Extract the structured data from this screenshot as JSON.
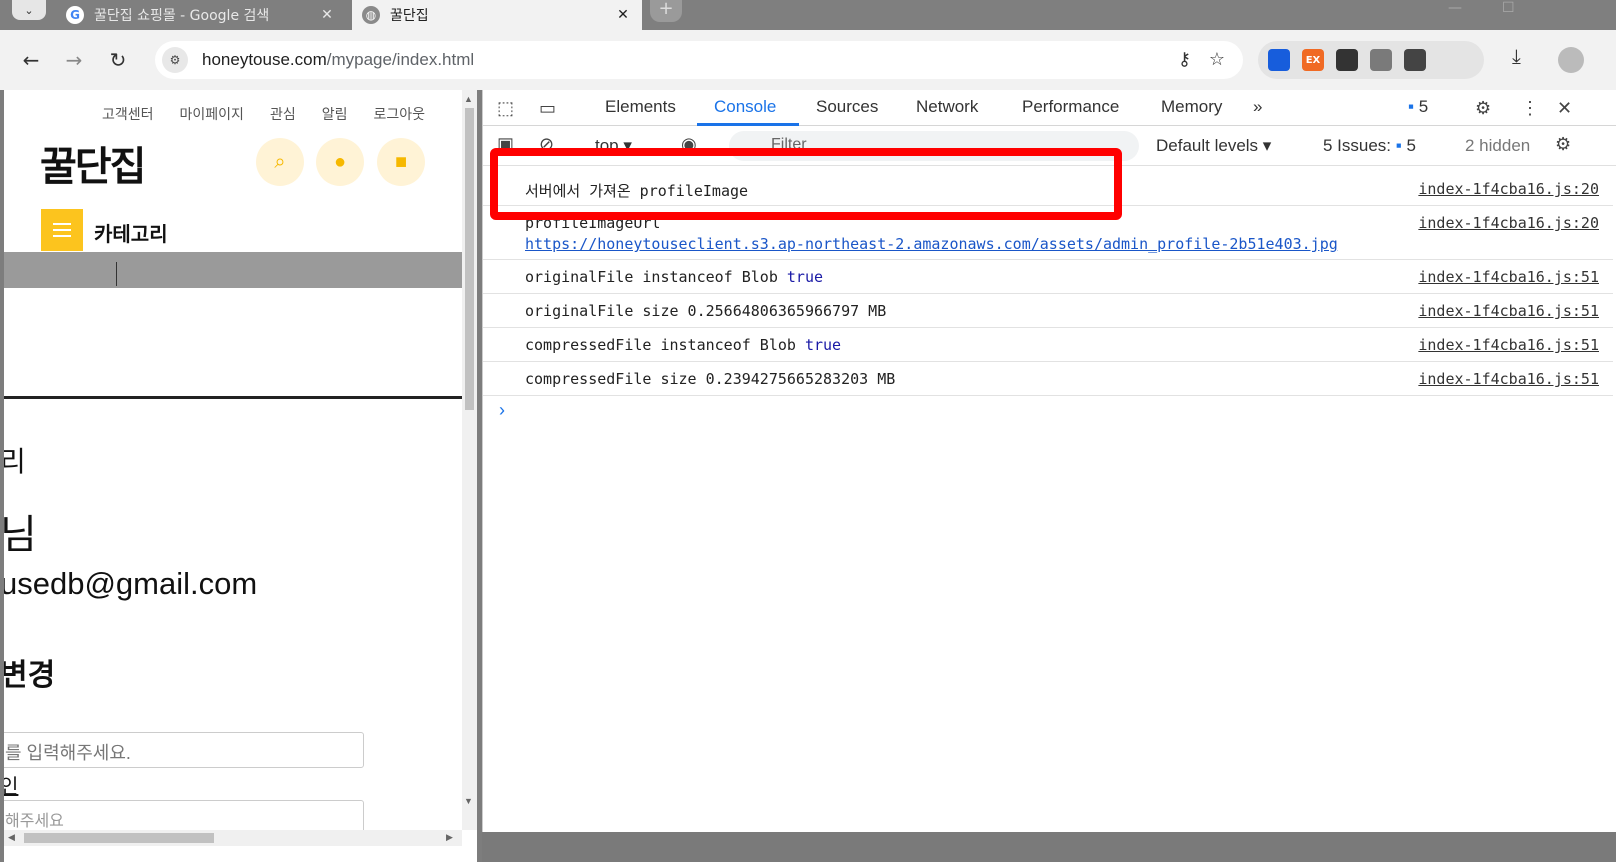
{
  "browser": {
    "tabs": [
      {
        "title": "꿀단집 쇼핑몰 - Google 검색",
        "active": false
      },
      {
        "title": "꿀단집",
        "active": true
      }
    ],
    "url_host": "honeytouse.com",
    "url_path": "/mypage/index.html",
    "extensions": [
      {
        "name": "bitwarden-icon",
        "label": "",
        "color": "#175ddc"
      },
      {
        "name": "ex-extension-icon",
        "label": "EX",
        "color": "#f06a24"
      },
      {
        "name": "notion-clipper-icon",
        "label": "",
        "color": "#333333"
      },
      {
        "name": "react-devtools-icon",
        "label": "",
        "color": "#7a7a7a"
      },
      {
        "name": "puzzle-extensions-icon",
        "label": "",
        "color": "#444444"
      }
    ]
  },
  "page": {
    "util_nav": [
      "고객센터",
      "마이페이지",
      "관심",
      "알림",
      "로그아웃"
    ],
    "logo": "꿀단집",
    "category_label": "카테고리",
    "heading_partial": "리",
    "name_partial": "님",
    "email_partial": "usedb@gmail.com",
    "change_heading_partial": "변경",
    "input_placeholder_partial": "를 입력해주세요.",
    "link_partial": "인",
    "input2_partial": "해주세요"
  },
  "devtools": {
    "tabs": [
      "Elements",
      "Console",
      "Sources",
      "Network",
      "Performance",
      "Memory"
    ],
    "active_tab": "Console",
    "issues_badge": "5",
    "context": "top",
    "filter_placeholder": "Filter",
    "default_levels": "Default levels",
    "issues_label": "5 Issues:",
    "issues_count": "5",
    "hidden_label": "2 hidden",
    "console": [
      {
        "text": "서버에서 가져온 profileImage",
        "kw": "",
        "src": "index-1f4cba16.js:20"
      },
      {
        "text": "profileImageUrl",
        "kw": "",
        "src": "index-1f4cba16.js:20",
        "url": "https://honeytouseclient.s3.ap-northeast-2.amazonaws.com/assets/admin_profile-2b51e403.jpg"
      },
      {
        "text": "originalFile instanceof Blob ",
        "kw": "true",
        "src": "index-1f4cba16.js:51"
      },
      {
        "text": "originalFile size 0.25664806365966797 MB",
        "kw": "",
        "src": "index-1f4cba16.js:51"
      },
      {
        "text": "compressedFile instanceof Blob ",
        "kw": "true",
        "src": "index-1f4cba16.js:51"
      },
      {
        "text": "compressedFile size 0.2394275665283203 MB",
        "kw": "",
        "src": "index-1f4cba16.js:51"
      }
    ],
    "prompt_symbol": "›"
  },
  "colors": {
    "accent": "#fcc41e",
    "devtools_blue": "#1a73e8",
    "highlight": "#ff0000"
  }
}
